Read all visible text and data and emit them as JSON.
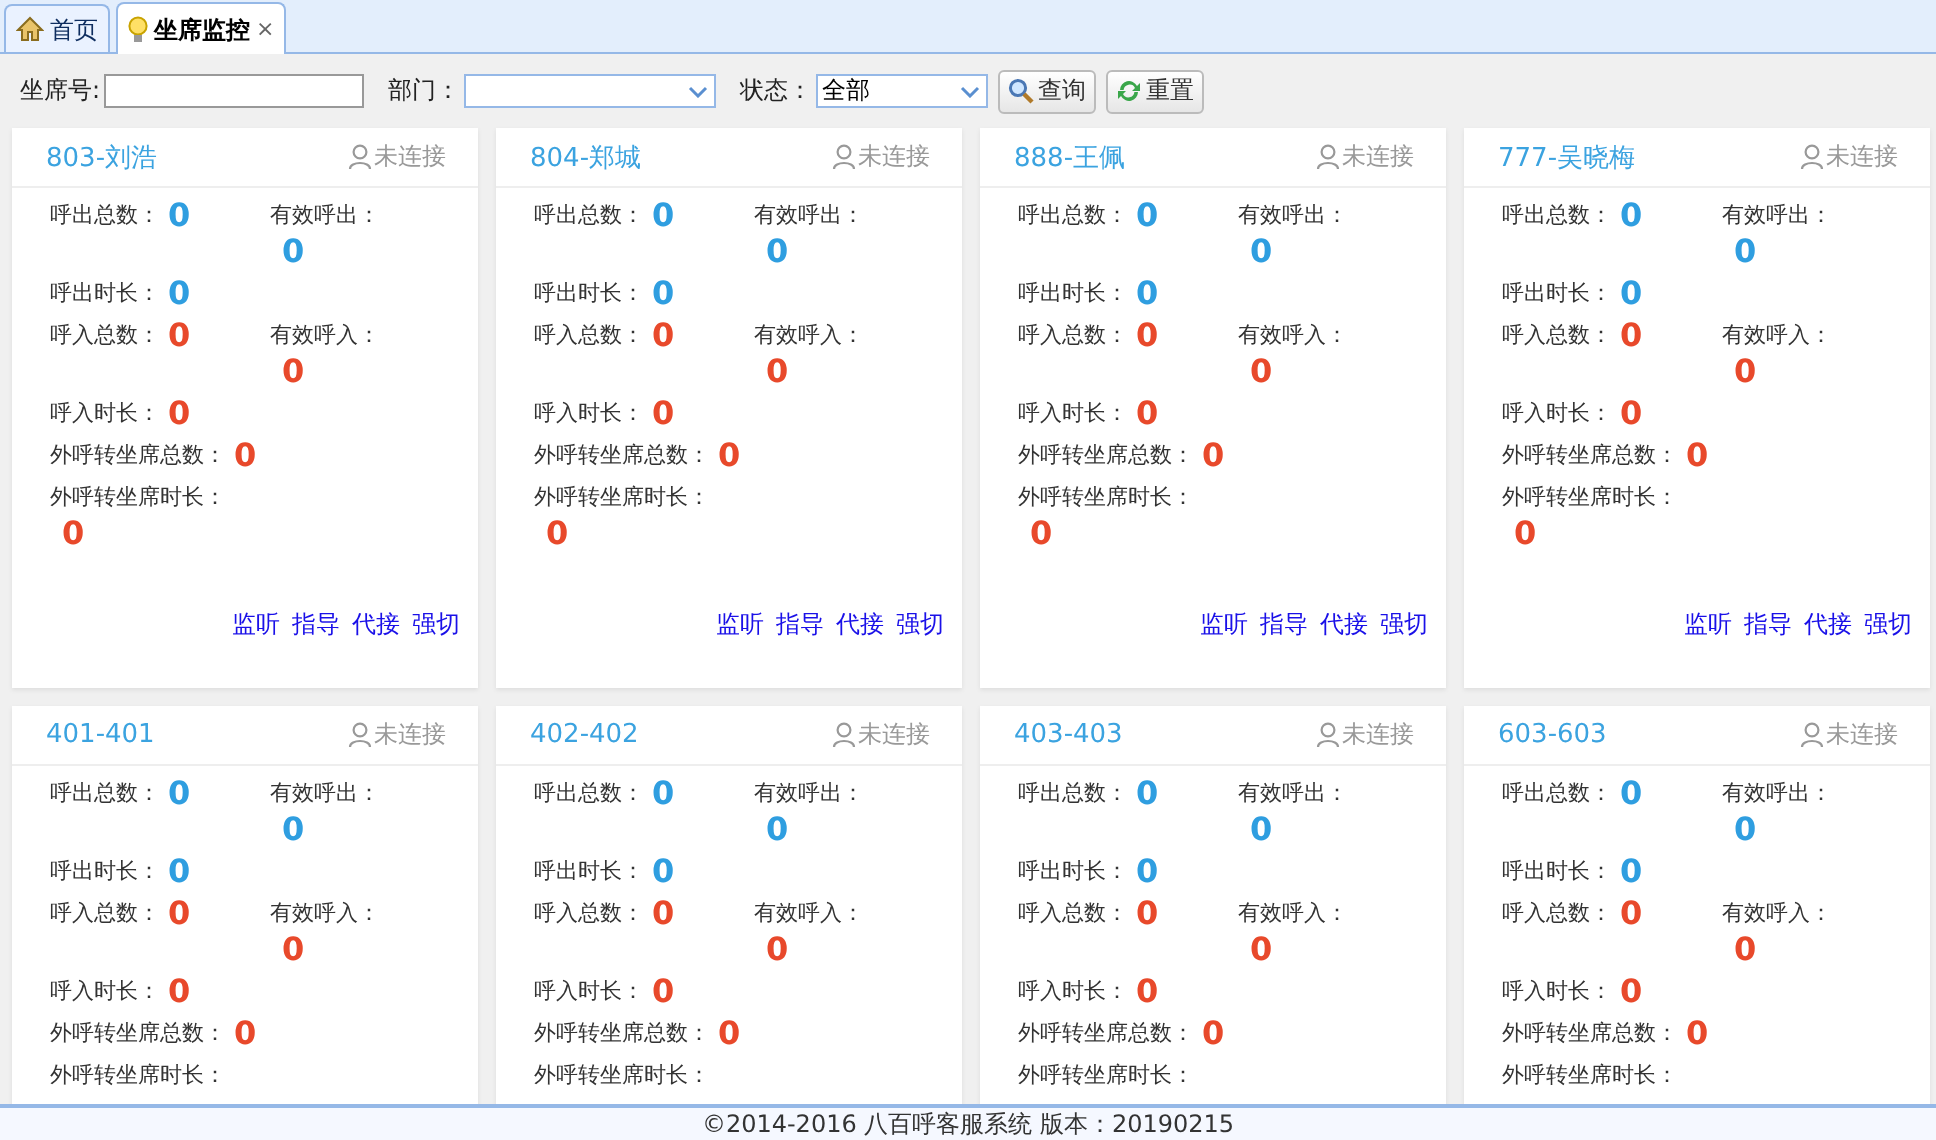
{
  "tabs": [
    {
      "label": "首页",
      "selected": false
    },
    {
      "label": "坐席监控",
      "selected": true,
      "close": "×"
    }
  ],
  "filters": {
    "seat_label": "坐席号:",
    "dept_label": "部门：",
    "status_label": "状态：",
    "status_value": "全部",
    "search_button": "查询",
    "reset_button": "重置"
  },
  "cards": [
    {
      "name": "803-刘浩",
      "status": "未连接",
      "stats": [
        [
          {
            "label": "呼出总数：",
            "value": "0",
            "kind": "inline"
          },
          {
            "label": "有效呼出：",
            "value": "0",
            "kind": "stacked"
          }
        ],
        [
          {
            "label": "呼出时长：",
            "value": "0",
            "kind": "inline"
          }
        ],
        [
          {
            "label": "呼入总数：",
            "value": "0",
            "kind": "inline"
          },
          {
            "label": "有效呼入：",
            "value": "0",
            "kind": "stacked"
          }
        ],
        [
          {
            "label": "呼入时长：",
            "value": "0",
            "kind": "inline"
          }
        ],
        [
          {
            "label": "外呼转坐席总数：",
            "value": "0",
            "kind": "inline"
          }
        ],
        [
          {
            "label": "外呼转坐席时长：",
            "value": "0",
            "kind": "stacked"
          }
        ]
      ],
      "actions": [
        "监听",
        "指导",
        "代接",
        "强切"
      ]
    },
    {
      "name": "804-郑城",
      "status": "未连接",
      "stats": [
        [
          {
            "label": "呼出总数：",
            "value": "0",
            "kind": "inline"
          },
          {
            "label": "有效呼出：",
            "value": "0",
            "kind": "stacked"
          }
        ],
        [
          {
            "label": "呼出时长：",
            "value": "0",
            "kind": "inline"
          }
        ],
        [
          {
            "label": "呼入总数：",
            "value": "0",
            "kind": "inline"
          },
          {
            "label": "有效呼入：",
            "value": "0",
            "kind": "stacked"
          }
        ],
        [
          {
            "label": "呼入时长：",
            "value": "0",
            "kind": "inline"
          }
        ],
        [
          {
            "label": "外呼转坐席总数：",
            "value": "0",
            "kind": "inline"
          }
        ],
        [
          {
            "label": "外呼转坐席时长：",
            "value": "0",
            "kind": "stacked"
          }
        ]
      ],
      "actions": [
        "监听",
        "指导",
        "代接",
        "强切"
      ]
    },
    {
      "name": "888-王佩",
      "status": "未连接",
      "stats": [
        [
          {
            "label": "呼出总数：",
            "value": "0",
            "kind": "inline"
          },
          {
            "label": "有效呼出：",
            "value": "0",
            "kind": "stacked"
          }
        ],
        [
          {
            "label": "呼出时长：",
            "value": "0",
            "kind": "inline"
          }
        ],
        [
          {
            "label": "呼入总数：",
            "value": "0",
            "kind": "inline"
          },
          {
            "label": "有效呼入：",
            "value": "0",
            "kind": "stacked"
          }
        ],
        [
          {
            "label": "呼入时长：",
            "value": "0",
            "kind": "inline"
          }
        ],
        [
          {
            "label": "外呼转坐席总数：",
            "value": "0",
            "kind": "inline"
          }
        ],
        [
          {
            "label": "外呼转坐席时长：",
            "value": "0",
            "kind": "stacked"
          }
        ]
      ],
      "actions": [
        "监听",
        "指导",
        "代接",
        "强切"
      ]
    },
    {
      "name": "777-吴晓梅",
      "status": "未连接",
      "stats": [
        [
          {
            "label": "呼出总数：",
            "value": "0",
            "kind": "inline"
          },
          {
            "label": "有效呼出：",
            "value": "0",
            "kind": "stacked"
          }
        ],
        [
          {
            "label": "呼出时长：",
            "value": "0",
            "kind": "inline"
          }
        ],
        [
          {
            "label": "呼入总数：",
            "value": "0",
            "kind": "inline"
          },
          {
            "label": "有效呼入：",
            "value": "0",
            "kind": "stacked"
          }
        ],
        [
          {
            "label": "呼入时长：",
            "value": "0",
            "kind": "inline"
          }
        ],
        [
          {
            "label": "外呼转坐席总数：",
            "value": "0",
            "kind": "inline"
          }
        ],
        [
          {
            "label": "外呼转坐席时长：",
            "value": "0",
            "kind": "stacked"
          }
        ]
      ],
      "actions": [
        "监听",
        "指导",
        "代接",
        "强切"
      ]
    },
    {
      "name": "401-401",
      "status": "未连接",
      "stats": [
        [
          {
            "label": "呼出总数：",
            "value": "0",
            "kind": "inline"
          },
          {
            "label": "有效呼出：",
            "value": "0",
            "kind": "stacked"
          }
        ],
        [
          {
            "label": "呼出时长：",
            "value": "0",
            "kind": "inline"
          }
        ],
        [
          {
            "label": "呼入总数：",
            "value": "0",
            "kind": "inline"
          },
          {
            "label": "有效呼入：",
            "value": "0",
            "kind": "stacked"
          }
        ],
        [
          {
            "label": "呼入时长：",
            "value": "0",
            "kind": "inline"
          }
        ],
        [
          {
            "label": "外呼转坐席总数：",
            "value": "0",
            "kind": "inline"
          }
        ],
        [
          {
            "label": "外呼转坐席时长：",
            "kind": "stacked"
          }
        ]
      ]
    },
    {
      "name": "402-402",
      "status": "未连接",
      "stats": [
        [
          {
            "label": "呼出总数：",
            "value": "0",
            "kind": "inline"
          },
          {
            "label": "有效呼出：",
            "value": "0",
            "kind": "stacked"
          }
        ],
        [
          {
            "label": "呼出时长：",
            "value": "0",
            "kind": "inline"
          }
        ],
        [
          {
            "label": "呼入总数：",
            "value": "0",
            "kind": "inline"
          },
          {
            "label": "有效呼入：",
            "value": "0",
            "kind": "stacked"
          }
        ],
        [
          {
            "label": "呼入时长：",
            "value": "0",
            "kind": "inline"
          }
        ],
        [
          {
            "label": "外呼转坐席总数：",
            "value": "0",
            "kind": "inline"
          }
        ],
        [
          {
            "label": "外呼转坐席时长：",
            "kind": "stacked"
          }
        ]
      ]
    },
    {
      "name": "403-403",
      "status": "未连接",
      "stats": [
        [
          {
            "label": "呼出总数：",
            "value": "0",
            "kind": "inline"
          },
          {
            "label": "有效呼出：",
            "value": "0",
            "kind": "stacked"
          }
        ],
        [
          {
            "label": "呼出时长：",
            "value": "0",
            "kind": "inline"
          }
        ],
        [
          {
            "label": "呼入总数：",
            "value": "0",
            "kind": "inline"
          },
          {
            "label": "有效呼入：",
            "value": "0",
            "kind": "stacked"
          }
        ],
        [
          {
            "label": "呼入时长：",
            "value": "0",
            "kind": "inline"
          }
        ],
        [
          {
            "label": "外呼转坐席总数：",
            "value": "0",
            "kind": "inline"
          }
        ],
        [
          {
            "label": "外呼转坐席时长：",
            "kind": "stacked"
          }
        ]
      ]
    },
    {
      "name": "603-603",
      "status": "未连接",
      "stats": [
        [
          {
            "label": "呼出总数：",
            "value": "0",
            "kind": "inline"
          },
          {
            "label": "有效呼出：",
            "value": "0",
            "kind": "stacked"
          }
        ],
        [
          {
            "label": "呼出时长：",
            "value": "0",
            "kind": "inline"
          }
        ],
        [
          {
            "label": "呼入总数：",
            "value": "0",
            "kind": "inline"
          },
          {
            "label": "有效呼入：",
            "value": "0",
            "kind": "stacked"
          }
        ],
        [
          {
            "label": "呼入时长：",
            "value": "0",
            "kind": "inline"
          }
        ],
        [
          {
            "label": "外呼转坐席总数：",
            "value": "0",
            "kind": "inline"
          }
        ],
        [
          {
            "label": "外呼转坐席时长：",
            "kind": "stacked"
          }
        ]
      ]
    }
  ],
  "footer": "©2014-2016 八百呼客服系统 版本：20190215"
}
